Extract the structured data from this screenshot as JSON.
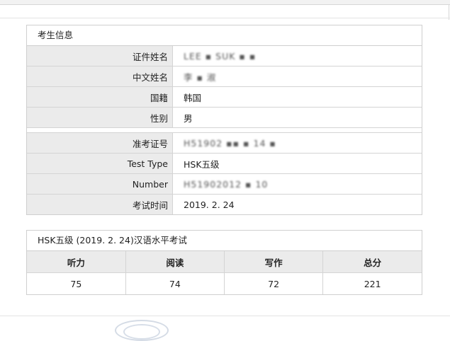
{
  "info": {
    "title": "考生信息",
    "rows": [
      {
        "label": "证件姓名",
        "value": "LEE ▪ SUK ▪ ▪"
      },
      {
        "label": "中文姓名",
        "value": "李 ▪ 淑"
      },
      {
        "label": "国籍",
        "value": "韩国"
      },
      {
        "label": "性别",
        "value": "男"
      },
      {
        "label": "准考证号",
        "value": "H51902 ▪▪ ▪ 14 ▪"
      },
      {
        "label": "Test Type",
        "value": "HSK五级"
      },
      {
        "label": "Number",
        "value": "H51902012 ▪ 10"
      },
      {
        "label": "考试时间",
        "value": "2019. 2. 24"
      }
    ]
  },
  "scores": {
    "title": "HSK五级 (2019. 2. 24)汉语水平考试",
    "headers": [
      "听力",
      "阅读",
      "写作",
      "总分"
    ],
    "values": [
      "75",
      "74",
      "72",
      "221"
    ]
  }
}
